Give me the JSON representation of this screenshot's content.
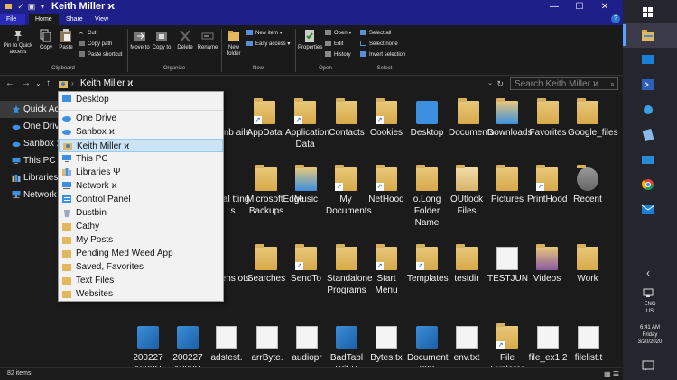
{
  "window": {
    "title": "Keith Miller ϰ",
    "quick_access_down": "▾",
    "controls": {
      "minimize": "—",
      "maximize": "☐",
      "close": "✕"
    }
  },
  "ribbon": {
    "tabs": [
      "File",
      "Home",
      "Share",
      "View"
    ],
    "help": "?",
    "clipboard": {
      "pin_label": "Pin to Quick access",
      "copy_label": "Copy",
      "paste_label": "Paste",
      "cut_label": "Cut",
      "copy_path_label": "Copy path",
      "paste_shortcut_label": "Paste shortcut",
      "group_label": "Clipboard"
    },
    "organize": {
      "move_to_label": "Move to",
      "copy_to_label": "Copy to",
      "delete_label": "Delete",
      "rename_label": "Rename",
      "group_label": "Organize"
    },
    "new": {
      "new_folder_label": "New folder",
      "new_item_label": "New item",
      "easy_access_label": "Easy access",
      "group_label": "New"
    },
    "open": {
      "properties_label": "Properties",
      "open_label": "Open",
      "edit_label": "Edit",
      "history_label": "History",
      "group_label": "Open"
    },
    "select": {
      "select_all_label": "Select all",
      "select_none_label": "Select none",
      "invert_label": "Invert selection",
      "group_label": "Select"
    }
  },
  "address_bar": {
    "back": "←",
    "forward": "→",
    "recent": "⌄",
    "up": "↑",
    "chevron": "›",
    "path": "Keith Miller ϰ",
    "dropdown_arrow": "⌄",
    "refresh": "↻",
    "search_placeholder": "Search Keith Miller ϰ",
    "search_icon": "⌕"
  },
  "nav_pane": {
    "items": [
      {
        "label": "Quick Access",
        "icon": "star-icon"
      },
      {
        "label": "One Drive",
        "icon": "cloud-icon"
      },
      {
        "label": "Sanbox ϰ",
        "icon": "cloud-icon"
      },
      {
        "label": "This PC",
        "icon": "computer-icon"
      },
      {
        "label": "Libraries Ψ",
        "icon": "library-icon"
      },
      {
        "label": "Network ϰ",
        "icon": "network-icon"
      }
    ]
  },
  "dropdown": {
    "items": [
      {
        "label": "Desktop"
      },
      {
        "label": "One Drive"
      },
      {
        "label": "Sanbox ϰ"
      },
      {
        "label": "Keith Miller ϰ"
      },
      {
        "label": "This PC"
      },
      {
        "label": "Libraries Ψ"
      },
      {
        "label": "Network ϰ"
      },
      {
        "label": "Control Panel"
      },
      {
        "label": "Dustbin"
      },
      {
        "label": "Cathy"
      },
      {
        "label": "My Posts"
      },
      {
        "label": "Pending Med Weed App"
      },
      {
        "label": "Saved, Favorites"
      },
      {
        "label": "Text Files"
      },
      {
        "label": "Websites"
      }
    ]
  },
  "files": {
    "row1": [
      "umb ails",
      "AppData",
      "Application Data",
      "Contacts",
      "Cookies",
      "Desktop",
      "Documents",
      "Downloads",
      "Favorites",
      "Google_files"
    ],
    "row2": [
      "ical tting s",
      "MicrosoftEdge Backups",
      "Music",
      "My Documents",
      "NetHood",
      "o.Long Folder Name",
      "OUtlook Files",
      "Pictures",
      "PrintHood",
      "Recent"
    ],
    "row3": [
      "eens ots",
      "Searches",
      "SendTo",
      "Standalone Programs",
      "Start Menu",
      "Templates",
      "testdir",
      "TESTJUN",
      "Videos",
      "Work"
    ],
    "row4": [
      "200227 1232H",
      "200227 1232H",
      "adstest.",
      "arrByte.",
      "audiopr",
      "BadTabl Wif-D",
      "Bytes.tx",
      "Document 200",
      "env.txt",
      "File Explorer",
      "file_ex1 2",
      "filelist.t"
    ]
  },
  "status": {
    "count": "82 items",
    "views": "▦ ☰"
  },
  "taskbar": {
    "lang": "ENG",
    "region": "US",
    "time": "6:41 AM",
    "day": "Friday",
    "date": "3/20/2020",
    "chevron": "‹"
  }
}
